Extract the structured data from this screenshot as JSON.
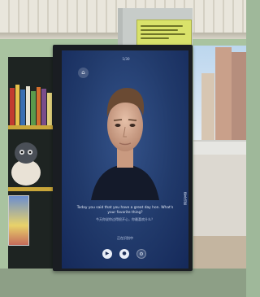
{
  "notice": {
    "lines": 4
  },
  "screen": {
    "top_label": "1/30",
    "subtitle": "Today you said that you have a great day hon. What's your favorite thing?",
    "subtitle_cn": "今天你说你过得很开心，你最喜欢什么？",
    "status_label": "正在识别中",
    "side_text": "更多功能"
  },
  "icons": {
    "home": "home-icon",
    "play": "play-icon",
    "mic": "microphone-icon",
    "settings": "gear-icon"
  },
  "colors": {
    "screen_bg": "#213a6b",
    "wall": "#a9c3a0",
    "notice": "#d9e26a"
  }
}
